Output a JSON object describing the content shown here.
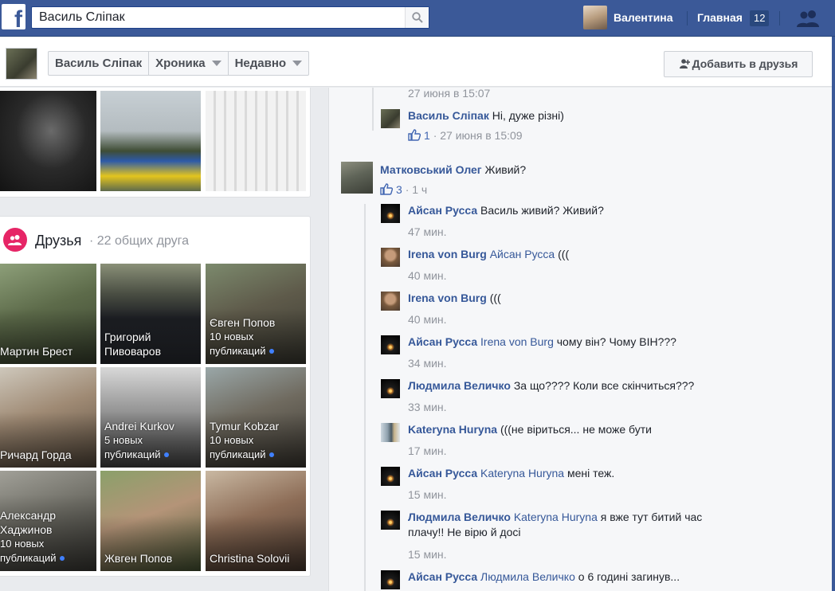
{
  "topbar": {
    "logo_letter": "f",
    "search_value": "Василь Сліпак",
    "user_name": "Валентина",
    "home_label": "Главная",
    "home_count": "12"
  },
  "subbar": {
    "page_name": "Василь Сліпак",
    "timeline_label": "Хроника",
    "recent_label": "Недавно",
    "add_friend_label": "Добавить в друзья"
  },
  "friends": {
    "title": "Друзья",
    "mutual": "· 22 общих друга",
    "tiles": [
      {
        "name": "Мартин Брест",
        "note": ""
      },
      {
        "name": "Григорий Пивоваров",
        "note": ""
      },
      {
        "name": "Євген Попов",
        "note": "10 новых публикаций"
      },
      {
        "name": "Ричард Горда",
        "note": ""
      },
      {
        "name": "Andrei Kurkov",
        "note": "5 новых публикаций"
      },
      {
        "name": "Tymur Kobzar",
        "note": "10 новых публикаций"
      },
      {
        "name": "Александр Хаджинов",
        "note": "10 новых публикаций"
      },
      {
        "name": "Жвген Попов",
        "note": ""
      },
      {
        "name": "Christina Solovii",
        "note": ""
      }
    ]
  },
  "comments": {
    "top_time": "27 июня в 15:07",
    "vasyl": {
      "name": "Василь Сліпак",
      "text": "Ні, дуже різні)",
      "likes": "1",
      "time": "· 27 июня в 15:09"
    },
    "olek": {
      "name": "Матковський Олег",
      "text": "Живий?",
      "likes": "3",
      "time": "· 1 ч"
    },
    "replies": [
      {
        "name": "Айсан Русса",
        "mention": "",
        "text": "Василь живий? Живий?",
        "time": "47 мин."
      },
      {
        "name": "Irena von Burg",
        "mention": "Айсан Русса",
        "text": "(((",
        "time": "40 мин."
      },
      {
        "name": "Irena von Burg",
        "mention": "",
        "text": "(((",
        "time": "40 мин."
      },
      {
        "name": "Айсан Русса",
        "mention": "Irena von Burg",
        "text": "чому він? Чому ВІН???",
        "time": "34 мин."
      },
      {
        "name": "Людмила Величко",
        "mention": "",
        "text": "За що???? Коли все скінчиться???",
        "time": "33 мин."
      },
      {
        "name": "Kateryna Huryna",
        "mention": "",
        "text": "(((не віриться... не може бути",
        "time": "17 мин."
      },
      {
        "name": "Айсан Русса",
        "mention": "Kateryna Huryna",
        "text": "мені теж.",
        "time": "15 мин."
      },
      {
        "name": "Людмила Величко",
        "mention": "Kateryna Huryna",
        "text": "я вже тут битий час плачу!! Не вірю й досі",
        "time": "15 мин."
      },
      {
        "name": "Айсан Русса",
        "mention": "Людмила Величко",
        "text": "о 6 годині загинув...",
        "time": ""
      }
    ]
  }
}
